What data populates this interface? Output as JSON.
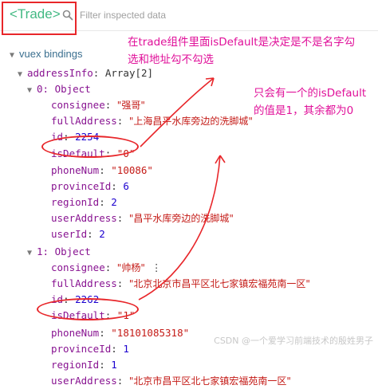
{
  "header": {
    "component_tag": "<Trade>",
    "filter_placeholder": "Filter inspected data"
  },
  "section": {
    "title": "vuex bindings"
  },
  "tree": {
    "root": {
      "key": "addressInfo",
      "type": "Array[2]"
    },
    "items": [
      {
        "index_label": "0: Object",
        "consignee_key": "consignee",
        "consignee": "\"强哥\"",
        "fullAddress_key": "fullAddress",
        "fullAddress": "\"上海昌平水库旁边的洗脚城\"",
        "id_key": "id",
        "id": "2254",
        "isDefault_key": "isDefault",
        "isDefault": "\"0\"",
        "phoneNum_key": "phoneNum",
        "phoneNum": "\"10086\"",
        "provinceId_key": "provinceId",
        "provinceId": "6",
        "regionId_key": "regionId",
        "regionId": "2",
        "userAddress_key": "userAddress",
        "userAddress": "\"昌平水库旁边的洗脚城\"",
        "userId_key": "userId",
        "userId": "2"
      },
      {
        "index_label": "1: Object",
        "consignee_key": "consignee",
        "consignee": "\"帅杨\"",
        "fullAddress_key": "fullAddress",
        "fullAddress": "\"北京北京市昌平区北七家镇宏福苑南一区\"",
        "id_key": "id",
        "id": "2262",
        "isDefault_key": "isDefault",
        "isDefault": "\"1\"",
        "phoneNum_key": "phoneNum",
        "phoneNum": "\"18101085318\"",
        "provinceId_key": "provinceId",
        "provinceId": "1",
        "regionId_key": "regionId",
        "regionId": "1",
        "userAddress_key": "userAddress",
        "userAddress": "\"北京市昌平区北七家镇宏福苑南一区\""
      }
    ]
  },
  "annotations": {
    "note1_line1": "在trade组件里面isDefault是决定是不是名字勾",
    "note1_line2": "选和地址勾不勾选",
    "note2_line1": "只会有一个的isDefault",
    "note2_line2": "的值是1，其余都为0"
  },
  "watermark": "CSDN @一个爱学习前端技术的殷姓男子",
  "colors": {
    "annotation": "#e0119a",
    "highlight": "#e8262a",
    "component": "#42b983"
  }
}
